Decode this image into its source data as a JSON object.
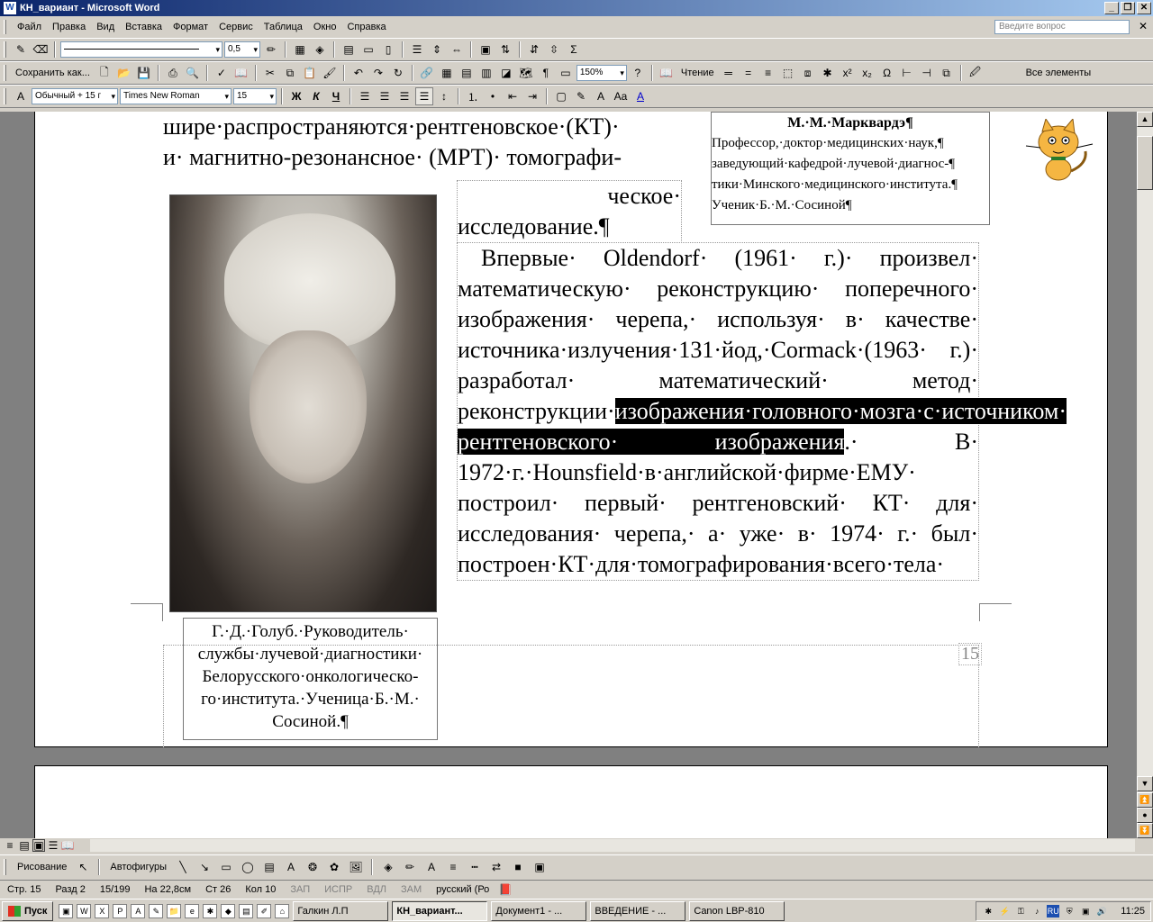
{
  "window": {
    "title": "КН_вариант - Microsoft Word"
  },
  "menu": {
    "items": [
      "Файл",
      "Правка",
      "Вид",
      "Вставка",
      "Формат",
      "Сервис",
      "Таблица",
      "Окно",
      "Справка"
    ],
    "question_placeholder": "Введите вопрос"
  },
  "toolbar1": {
    "line_weight": "0,5"
  },
  "toolbar2": {
    "save_as": "Сохранить как...",
    "zoom": "150%",
    "reading": "Чтение",
    "all_elements": "Все элементы"
  },
  "toolbar3": {
    "style": "Обычный + 15 г",
    "font": "Times New Roman",
    "size": "15"
  },
  "document": {
    "top_lines": [
      "шире·распространяются·рентгеновское·(КТ)·",
      "и· магнитно-резонансное· (МРТ)· томографи-"
    ],
    "top_cont_lines": [
      "ческое·",
      "исследование.¶"
    ],
    "main_paragraph": {
      "before_sel": "Впервые· Oldendorf· (1961· г.)· произвел· математическую· реконструкцию· поперечного· изображения· черепа,· используя· в· качестве· источника·излучения·131·йод,·Cormack·(1963· г.)· разработал· математический· метод· реконструкции·",
      "selected": "изображения·головного·мозга·с·источником· рентгеновского· изображения",
      "after_sel": ".· В· 1972·г.·Hounsfield·в·английской·фирме·ЕМУ· построил· первый· рентгеновский· КТ· для· исследования· черепа,· а· уже· в· 1974· г.· был· построен·КТ·для·томографирования·всего·тела·"
    },
    "sidebar": {
      "name": "М.·М.·Марквардэ¶",
      "lines": [
        "Профессор,·доктор·медицинских·наук,¶",
        "заведующий·кафедрой·лучевой·диагнос-¶",
        "тики·Минского·медицинского·института.¶",
        "Ученик·Б.·М.·Сосиной¶"
      ]
    },
    "photo_caption": "Г.·Д.·Голуб.·Руководитель· службы·лучевой·диагностики· Белорусского·онкологическо- го·института.·Ученица·Б.·М.· Сосиной.¶",
    "page_number": "15"
  },
  "drawbar": {
    "drawing": "Рисование",
    "autoshapes": "Автофигуры"
  },
  "status": {
    "page": "Стр. 15",
    "section": "Разд 2",
    "pages": "15/199",
    "at": "На 22,8см",
    "line": "Ст 26",
    "col": "Кол 10",
    "rec": "ЗАП",
    "trk": "ИСПР",
    "ext": "ВДЛ",
    "ovr": "ЗАМ",
    "lang": "русский (Ро"
  },
  "taskbar": {
    "start": "Пуск",
    "tasks": [
      "Галкин Л.П",
      "КН_вариант...",
      "Документ1 - ...",
      "ВВЕДЕНИЕ - ...",
      "Canon LBP-810"
    ],
    "lang": "RU",
    "time": "11:25"
  },
  "colors": {
    "titlebar": "#0a246a",
    "selection": "#000000",
    "chrome": "#d4d0c8"
  }
}
